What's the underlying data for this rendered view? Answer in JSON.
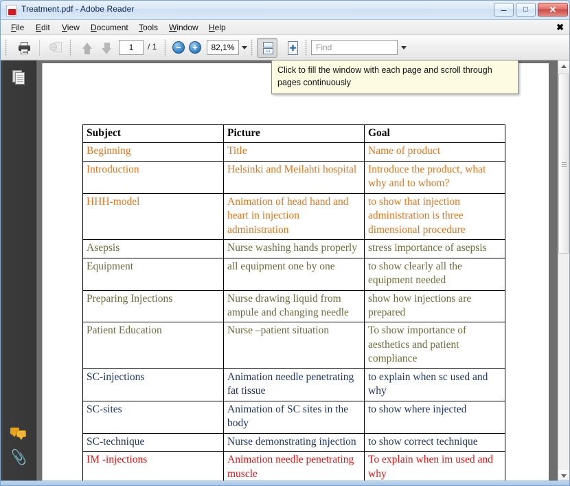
{
  "window": {
    "title": "Treatment.pdf - Adobe Reader",
    "app_icon": "pdf-file-icon",
    "controls": {
      "minimize": "–",
      "maximize": "□",
      "close": "✕"
    }
  },
  "menu": {
    "items": [
      {
        "label": "File",
        "accel": "F"
      },
      {
        "label": "Edit",
        "accel": "E"
      },
      {
        "label": "View",
        "accel": "V"
      },
      {
        "label": "Document",
        "accel": "D"
      },
      {
        "label": "Tools",
        "accel": "T"
      },
      {
        "label": "Window",
        "accel": "W"
      },
      {
        "label": "Help",
        "accel": "H"
      }
    ],
    "close_document_glyph": "✖"
  },
  "toolbar": {
    "print_icon": "printer-icon",
    "email_icon": "attach-to-email-icon",
    "prev_page_icon": "arrow-up-icon",
    "next_page_icon": "arrow-down-icon",
    "page_number": "1",
    "page_total": "/ 1",
    "zoom_out_glyph": "−",
    "zoom_in_glyph": "+",
    "zoom_value": "82,1%",
    "zoom_dropdown_icon": "chevron-down-icon",
    "fit_width_icon": "fit-width-icon",
    "fit_page_icon": "fit-page-icon",
    "find_placeholder": "Find",
    "find_value": "",
    "find_dropdown_icon": "chevron-down-icon"
  },
  "tooltip": {
    "text": "Click to fill the window with each page and scroll through pages continuously"
  },
  "nav_rail": {
    "items": [
      {
        "icon": "page-thumbnails-icon",
        "name": "pages-panel"
      },
      {
        "icon": "comments-icon",
        "name": "comments-panel"
      },
      {
        "icon": "paperclip-icon",
        "name": "attachments-panel"
      }
    ]
  },
  "scrollbar": {
    "up_arrow_icon": "scroll-up-icon",
    "down_arrow_icon": "scroll-down-icon",
    "grip_icon": "scrollbar-grip-icon"
  },
  "document": {
    "table": {
      "headers": [
        "Subject",
        "Picture",
        "Goal"
      ],
      "rows": [
        {
          "color_key": "orange",
          "color": "#E8751A",
          "cells": [
            "Beginning",
            "Title",
            "Name of product"
          ]
        },
        {
          "color_key": "orange",
          "color": "#E8751A",
          "cells": [
            "Introduction",
            "Helsinki and Meilahti hospital",
            "Introduce the product, what why and to whom?"
          ]
        },
        {
          "color_key": "orange",
          "color": "#E8751A",
          "cells": [
            "HHH-model",
            "Animation of head hand and heart in injection administration",
            "to show that injection administration is three dimensional procedure"
          ]
        },
        {
          "color_key": "olive",
          "color": "#6E6B3D",
          "cells": [
            "Asepsis",
            "Nurse washing hands properly",
            "stress importance of asepsis"
          ]
        },
        {
          "color_key": "olive",
          "color": "#6E6B3D",
          "cells": [
            "Equipment",
            "all equipment one by one",
            "to show clearly all the equipment needed"
          ]
        },
        {
          "color_key": "olive",
          "color": "#6E6B3D",
          "cells": [
            "Preparing Injections",
            "Nurse drawing liquid from ampule and changing needle",
            "show how injections are prepared"
          ]
        },
        {
          "color_key": "olive",
          "color": "#6E6B3D",
          "cells": [
            "Patient Education",
            "Nurse –patient situation",
            "To show importance of aesthetics and patient compliance"
          ]
        },
        {
          "color_key": "navy",
          "color": "#1F3566",
          "cells": [
            "SC-injections",
            "Animation needle penetrating fat tissue",
            "to explain when sc used and why"
          ]
        },
        {
          "color_key": "navy",
          "color": "#1F3566",
          "cells": [
            "SC-sites",
            "Animation of SC sites in the body",
            "to show where injected"
          ]
        },
        {
          "color_key": "navy",
          "color": "#1F3566",
          "cells": [
            "SC-technique",
            "Nurse demonstrating injection",
            "to show correct technique"
          ]
        },
        {
          "color_key": "red",
          "color": "#EE1111",
          "cells": [
            "IM -injections",
            "Animation needle penetrating muscle",
            "To explain when im used and why"
          ]
        }
      ]
    }
  }
}
